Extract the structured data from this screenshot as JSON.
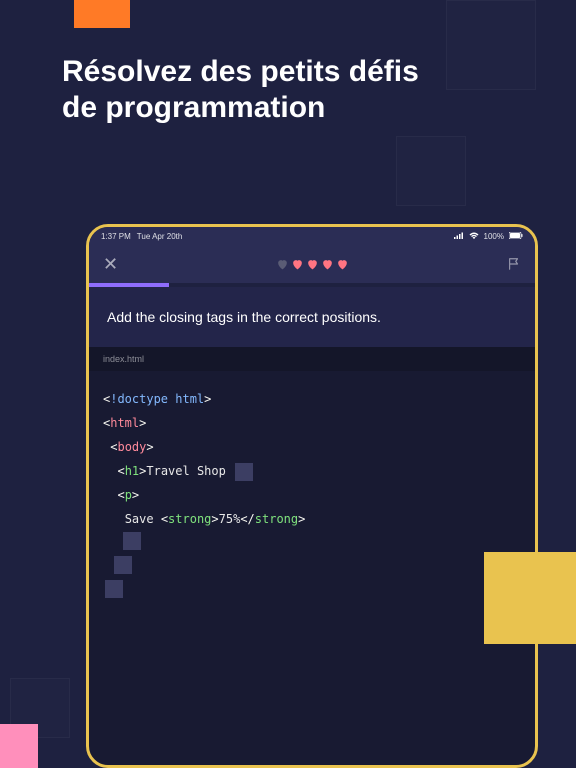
{
  "headline_l1": "Résolvez des petits défis",
  "headline_l2": "de programmation",
  "status": {
    "time": "1:37 PM",
    "date": "Tue Apr 20th",
    "battery": "100%"
  },
  "hearts": {
    "filled": 4,
    "grey": 1
  },
  "instruction": "Add the closing tags in the correct positions.",
  "file": "index.html",
  "code": {
    "doctype": "!doctype html",
    "html": "html",
    "body": "body",
    "h1": "h1",
    "h1_text": "Travel Shop",
    "p": "p",
    "save_text": "Save ",
    "strong": "strong",
    "percent": "75%"
  }
}
